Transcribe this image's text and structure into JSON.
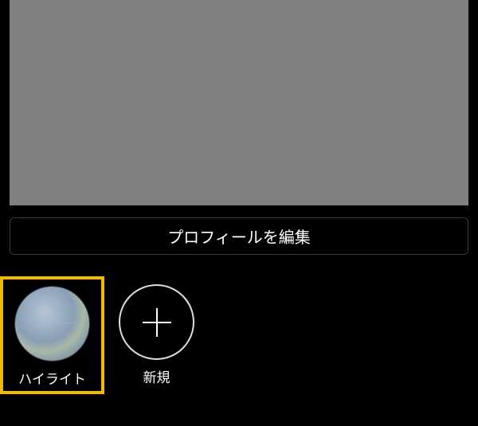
{
  "profile": {
    "edit_button_label": "プロフィールを編集"
  },
  "highlights": {
    "items": [
      {
        "label": "ハイライト",
        "icon": "highlight-thumbnail",
        "selected": true
      },
      {
        "label": "新規",
        "icon": "plus-icon",
        "selected": false
      }
    ]
  },
  "colors": {
    "background": "#000000",
    "content_placeholder": "#808080",
    "selection_border": "#f5b800",
    "text": "#ffffff",
    "border": "#3a3a3a"
  }
}
